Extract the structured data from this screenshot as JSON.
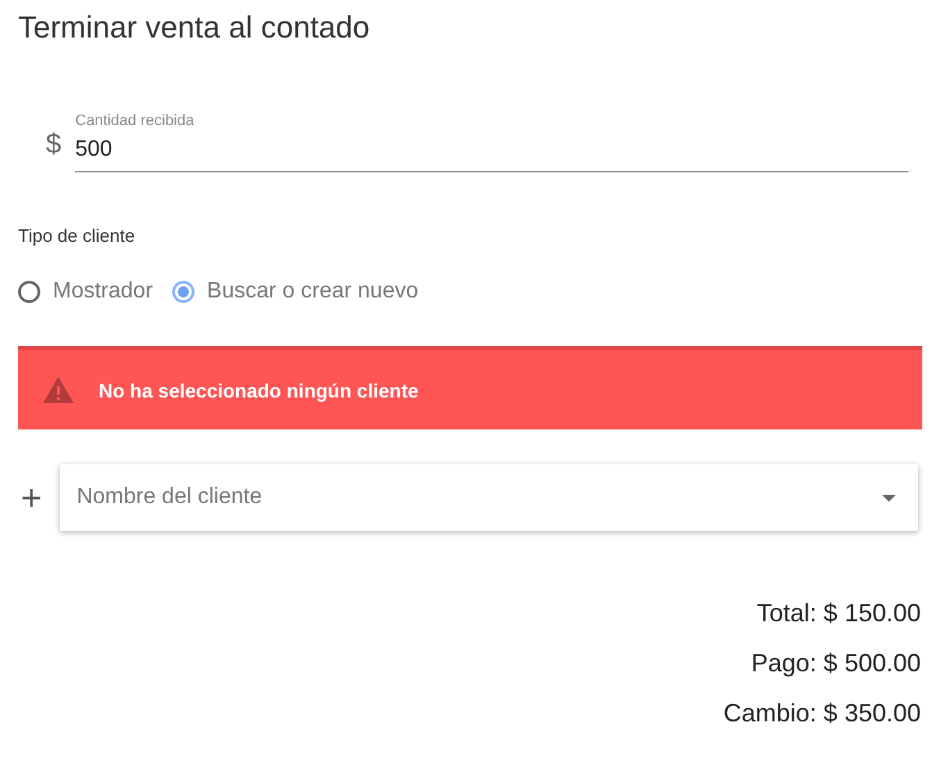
{
  "title": "Terminar venta al contado",
  "amount_field": {
    "label": "Cantidad recibida",
    "prefix": "$",
    "value": "500"
  },
  "customer_type": {
    "label": "Tipo de cliente",
    "options": [
      {
        "label": "Mostrador",
        "selected": false
      },
      {
        "label": "Buscar o crear nuevo",
        "selected": true
      }
    ]
  },
  "alert": {
    "kind": "error",
    "message": "No ha seleccionado ningún cliente"
  },
  "customer_select": {
    "add_icon": "+",
    "placeholder": "Nombre del cliente"
  },
  "totals": [
    {
      "text": "Total: $ 150.00"
    },
    {
      "text": "Pago: $ 500.00"
    },
    {
      "text": "Cambio: $ 350.00"
    }
  ]
}
